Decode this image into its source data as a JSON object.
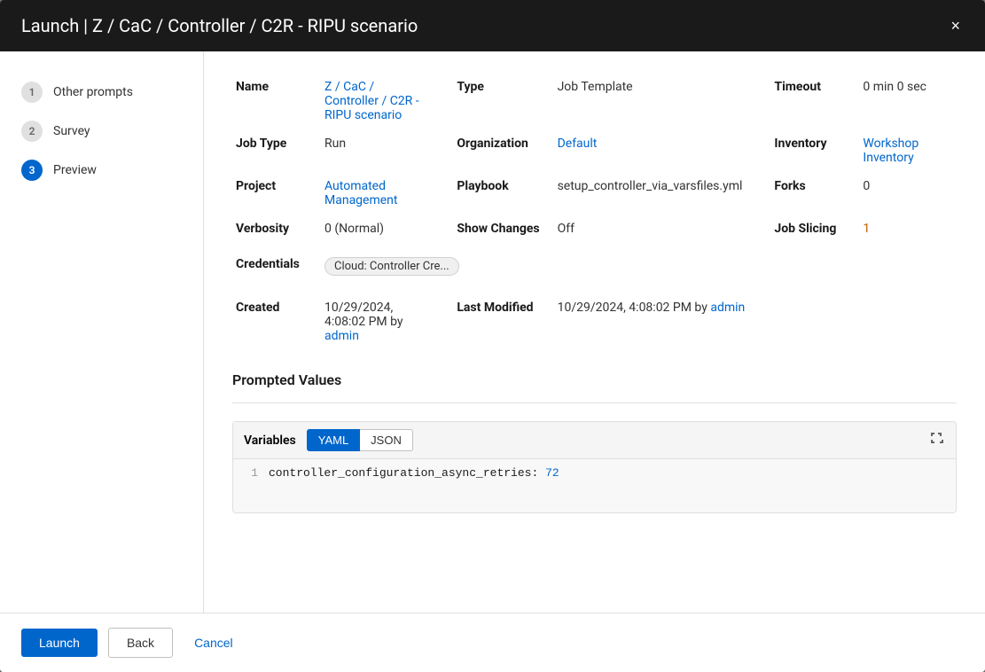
{
  "modal": {
    "title": "Launch | Z / CaC / Controller / C2R - RIPU scenario",
    "close_label": "×"
  },
  "sidebar": {
    "items": [
      {
        "id": "other-prompts",
        "step": "1",
        "label": "Other prompts",
        "state": "inactive"
      },
      {
        "id": "survey",
        "step": "2",
        "label": "Survey",
        "state": "inactive"
      },
      {
        "id": "preview",
        "step": "3",
        "label": "Preview",
        "state": "active"
      }
    ]
  },
  "details": {
    "name_label": "Name",
    "name_value": "Z / CaC / Controller / C2R - RIPU scenario",
    "type_label": "Type",
    "type_value": "Job Template",
    "timeout_label": "Timeout",
    "timeout_value": "0 min 0 sec",
    "job_type_label": "Job Type",
    "job_type_value": "Run",
    "organization_label": "Organization",
    "organization_value": "Default",
    "inventory_label": "Inventory",
    "inventory_value": "Workshop Inventory",
    "project_label": "Project",
    "project_value": "Automated Management",
    "playbook_label": "Playbook",
    "playbook_value": "setup_controller_via_varsfiles.yml",
    "forks_label": "Forks",
    "forks_value": "0",
    "verbosity_label": "Verbosity",
    "verbosity_value": "0 (Normal)",
    "show_changes_label": "Show Changes",
    "show_changes_value": "Off",
    "job_slicing_label": "Job Slicing",
    "job_slicing_value": "1",
    "credentials_label": "Credentials",
    "credential_tag": "Cloud: Controller Cre...",
    "created_label": "Created",
    "created_value": "10/29/2024, 4:08:02 PM by",
    "created_by": "admin",
    "last_modified_label": "Last Modified",
    "last_modified_value": "10/29/2024, 4:08:02 PM by",
    "last_modified_by": "admin"
  },
  "prompted_values": {
    "section_title": "Prompted Values",
    "variables_label": "Variables",
    "tab_yaml": "YAML",
    "tab_json": "JSON",
    "code_line": "controller_configuration_async_retries:",
    "code_value": "72"
  },
  "footer": {
    "launch_label": "Launch",
    "back_label": "Back",
    "cancel_label": "Cancel"
  }
}
